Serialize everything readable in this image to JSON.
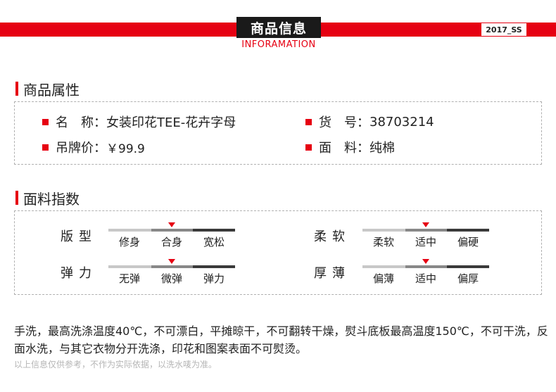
{
  "header": {
    "title": "商品信息",
    "subtitle": "INFORAMATION",
    "season": "2017_SS",
    "accent_color": "#e60012"
  },
  "attributes_section": {
    "title": "商品属性",
    "name_label": "名　称：",
    "name_value": "女装印花TEE-花卉字母",
    "sku_label": "货　号：",
    "sku_value": "38703214",
    "price_label": "吊牌价：",
    "price_value": "￥99.9",
    "material_label": "面　料：",
    "material_value": "纯棉"
  },
  "fabric_section": {
    "title": "面料指数",
    "scales": [
      {
        "label": "版型",
        "options": [
          "修身",
          "合身",
          "宽松"
        ],
        "selected": "合身"
      },
      {
        "label": "柔软",
        "options": [
          "柔软",
          "适中",
          "偏硬"
        ],
        "selected": "适中"
      },
      {
        "label": "弹力",
        "options": [
          "无弹",
          "微弹",
          "弹力"
        ],
        "selected": "微弹"
      },
      {
        "label": "厚薄",
        "options": [
          "偏薄",
          "适中",
          "偏厚"
        ],
        "selected": "适中"
      }
    ]
  },
  "care_text": "手洗，最高洗涤温度40℃，不可漂白，平摊晾干，不可翻转干燥，熨斗底板最高温度150℃，不可干洗，反面水洗，与其它衣物分开洗涤，印花和图案表面不可熨烫。",
  "note": "以上信息仅供参考，不作为实际依据，以洗水唛为准。"
}
